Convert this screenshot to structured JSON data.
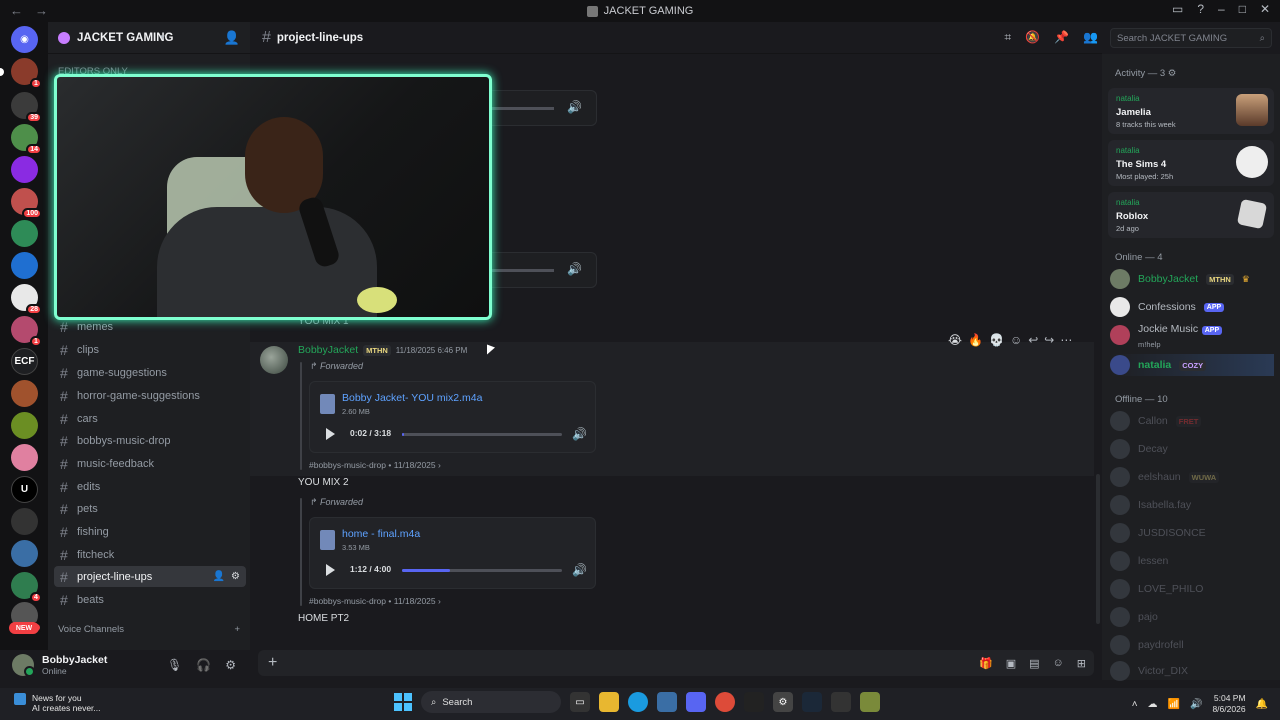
{
  "titlebar": {
    "title": "JACKET GAMING",
    "back": "←",
    "forward": "→"
  },
  "server": {
    "name": "JACKET GAMING"
  },
  "categories": {
    "editors_only": "EDITORS ONLY",
    "voice_channels": "Voice Channels"
  },
  "channels": [
    {
      "name": "memes"
    },
    {
      "name": "clips"
    },
    {
      "name": "game-suggestions"
    },
    {
      "name": "horror-game-suggestions"
    },
    {
      "name": "cars"
    },
    {
      "name": "bobbys-music-drop"
    },
    {
      "name": "music-feedback"
    },
    {
      "name": "edits"
    },
    {
      "name": "pets"
    },
    {
      "name": "fishing"
    },
    {
      "name": "fitcheck"
    },
    {
      "name": "project-line-ups",
      "active": true
    },
    {
      "name": "beats"
    }
  ],
  "rail": {
    "badges": [
      "1",
      "39",
      "14",
      "100",
      "28",
      "1",
      "4",
      "1"
    ],
    "ecf_label": "ECF",
    "u_label": "U",
    "new_label": "NEW"
  },
  "user": {
    "name": "BobbyJacket",
    "status": "Online"
  },
  "chat_header": {
    "channel": "project-line-ups",
    "search_placeholder": "Search JACKET GAMING"
  },
  "message": {
    "author": "BobbyJacket",
    "tag": "MTHN",
    "timestamp": "11/18/2025 6:46 PM",
    "forwarded_label": "Forwarded",
    "obscured_text": "YOU MIX 1",
    "attachments": [
      {
        "filename": "Bobby Jacket- YOU mix2.m4a",
        "size": "2.60 MB",
        "time": "0:02 / 3:18",
        "progress": 0.01,
        "source": "#bobbys-music-drop",
        "date": "11/18/2025",
        "caption": "YOU MIX 2"
      },
      {
        "filename": "home - final.m4a",
        "size": "3.53 MB",
        "time": "1:12 / 4:00",
        "progress": 0.3,
        "source": "#bobbys-music-drop",
        "date": "11/18/2025",
        "caption": "HOME PT2"
      }
    ],
    "reactions": [
      "😭",
      "🔥",
      "💀"
    ]
  },
  "members": {
    "activity_header": "Activity — 3",
    "activities": [
      {
        "user": "natalia",
        "title": "Jamelia",
        "detail": "8 tracks this week"
      },
      {
        "user": "natalia",
        "title": "The Sims 4",
        "detail": "Most played: 25h"
      },
      {
        "user": "natalia",
        "title": "Roblox",
        "detail": "2d ago"
      }
    ],
    "online_header": "Online — 4",
    "online": [
      {
        "name": "BobbyJacket",
        "tag": "MTHN",
        "color": "#23a559"
      },
      {
        "name": "Confessions",
        "tag": "APP"
      },
      {
        "name": "Jockie Music",
        "tag": "APP",
        "sub": "m!help"
      },
      {
        "name": "natalia",
        "tag": "COZY",
        "color": "#23a559"
      }
    ],
    "offline_header": "Offline — 10",
    "offline": [
      {
        "name": "Callon",
        "tag": "FRET"
      },
      {
        "name": "Decay"
      },
      {
        "name": "eelshaun",
        "tag": "WUWA"
      },
      {
        "name": "Isabella.fay"
      },
      {
        "name": "JUSDISONCE"
      },
      {
        "name": "lessen"
      },
      {
        "name": "LOVE_PHILO"
      },
      {
        "name": "pajo"
      },
      {
        "name": "paydrofell"
      },
      {
        "name": "Victor_DIX"
      }
    ]
  },
  "taskbar": {
    "news_title": "News for you",
    "news_sub": "AI creates never...",
    "search": "Search",
    "time": "5:04 PM",
    "date": "8/6/2026"
  }
}
